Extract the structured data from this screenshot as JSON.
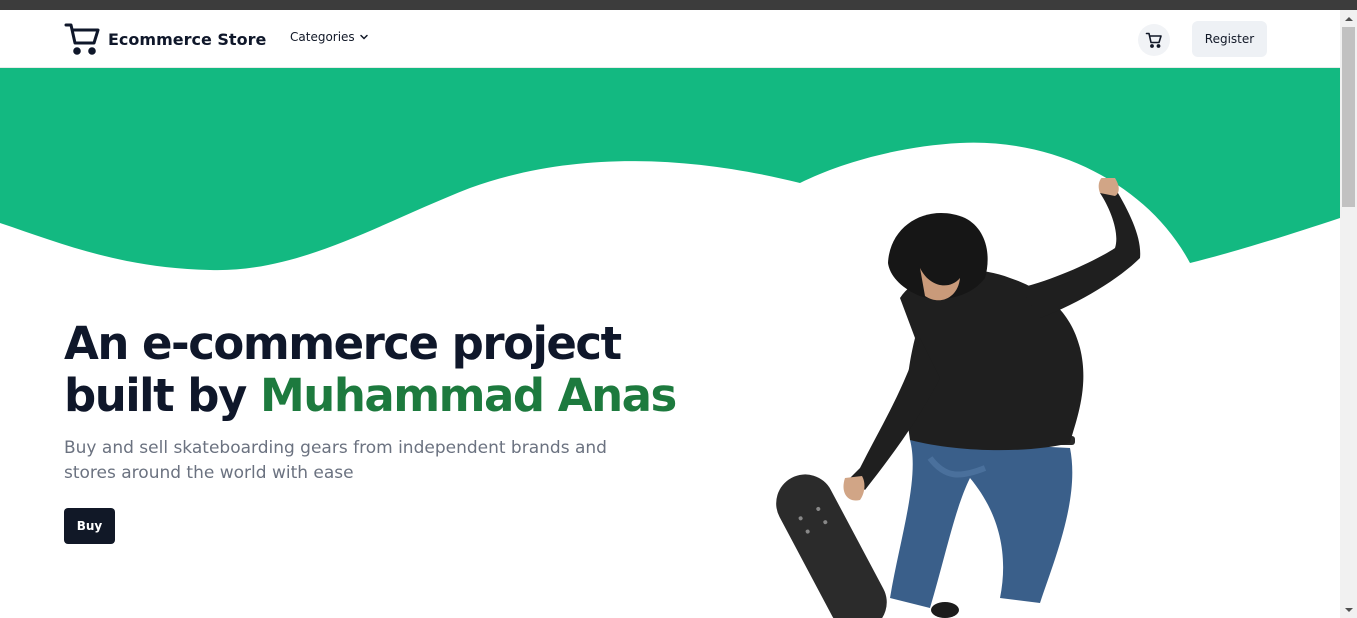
{
  "navbar": {
    "brand_name": "Ecommerce Store",
    "categories_label": "Categories",
    "register_label": "Register"
  },
  "hero": {
    "headline_line1": "An e-commerce project",
    "headline_prefix": "built by ",
    "headline_accent": "Muhammad Anas",
    "subtitle": "Buy and sell skateboarding gears from independent brands and stores around the world with ease",
    "buy_label": "Buy"
  },
  "colors": {
    "wave_green": "#13b981",
    "accent_name": "#1d7a3e",
    "dark": "#111827"
  },
  "icons": {
    "brand": "shopping-cart-icon",
    "categories": "chevron-down-icon",
    "cart": "shopping-cart-icon"
  }
}
